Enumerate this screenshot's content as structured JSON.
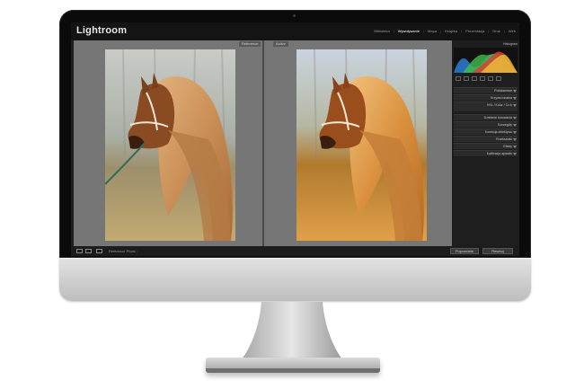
{
  "app": {
    "title": "Lightroom"
  },
  "modules": [
    {
      "label": "Biblioteka",
      "active": false
    },
    {
      "label": "Wywoływanie",
      "active": true
    },
    {
      "label": "Mapa",
      "active": false
    },
    {
      "label": "Książka",
      "active": false
    },
    {
      "label": "Prezentacja",
      "active": false
    },
    {
      "label": "Druk",
      "active": false
    },
    {
      "label": "Web",
      "active": false
    }
  ],
  "compare": {
    "left_label": "Reference",
    "right_label": "Active"
  },
  "right_panel": {
    "histogram_label": "Histogram",
    "sections": [
      "Podstawowe",
      "Krzywa tonalna",
      "HSL / Kolor / Cz-b",
      "Dzielenie tonowania",
      "Szczegóły",
      "Korekcja obiektywu",
      "Przekształć",
      "Efekty",
      "Kalibracja aparatu"
    ]
  },
  "bottom_bar": {
    "reference_label": "Reference Photo :",
    "previous_button": "Poprzednie",
    "reset_button": "Resetuj"
  },
  "colors": {
    "bezel": "#0b0b0b",
    "chin": "#cfcfcf",
    "workspace": "#767676",
    "panel": "#1e1e1e"
  }
}
